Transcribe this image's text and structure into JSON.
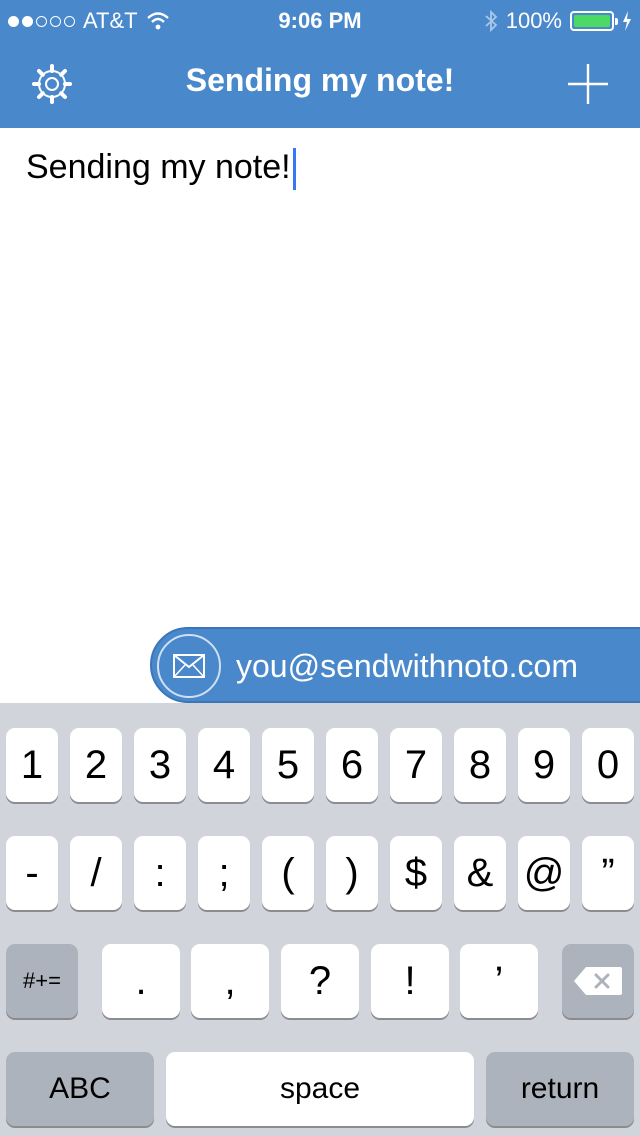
{
  "status_bar": {
    "carrier": "AT&T",
    "time": "9:06 PM",
    "battery": "100%"
  },
  "nav": {
    "title": "Sending my note!",
    "left_icon": "gear-icon",
    "right_icon": "plus-icon"
  },
  "note": {
    "text": "Sending my note!"
  },
  "send_bar": {
    "email": "you@sendwithnoto.com",
    "icon": "envelope-icon"
  },
  "keyboard": {
    "row1": [
      "1",
      "2",
      "3",
      "4",
      "5",
      "6",
      "7",
      "8",
      "9",
      "0"
    ],
    "row2": [
      "-",
      "/",
      ":",
      ";",
      "(",
      ")",
      "$",
      "&",
      "@",
      "”"
    ],
    "toggle": "#+=",
    "row3": [
      ".",
      ",",
      "?",
      "!",
      "’"
    ],
    "abc": "ABC",
    "space": "space",
    "return": "return"
  },
  "colors": {
    "accent": "#4a88cc",
    "battery": "#4cd964",
    "caret": "#3478f6",
    "keyboard_bg": "#d1d5db"
  }
}
